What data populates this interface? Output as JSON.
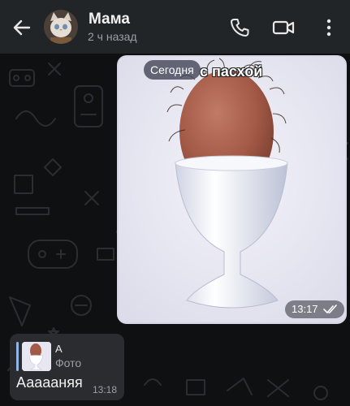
{
  "header": {
    "contact_name": "Мама",
    "last_seen": "2 ч назад",
    "icons": {
      "back": "arrow-left-icon",
      "call": "phone-icon",
      "video": "video-camera-icon",
      "menu": "more-vertical-icon"
    }
  },
  "chat": {
    "date_separator": "Сегодня",
    "outgoing_photo": {
      "caption_in_image": "с пасхой",
      "time": "13:17",
      "status": "read",
      "status_icon": "double-check-icon"
    },
    "incoming_message": {
      "reply_author": "А",
      "reply_type": "Фото",
      "text": "Аааааняя",
      "time": "13:18"
    }
  },
  "colors": {
    "header_bg": "#222528",
    "chat_bg": "#0f1012",
    "incoming_bubble": "#2a2c30",
    "reply_accent": "#8fb6e6"
  }
}
